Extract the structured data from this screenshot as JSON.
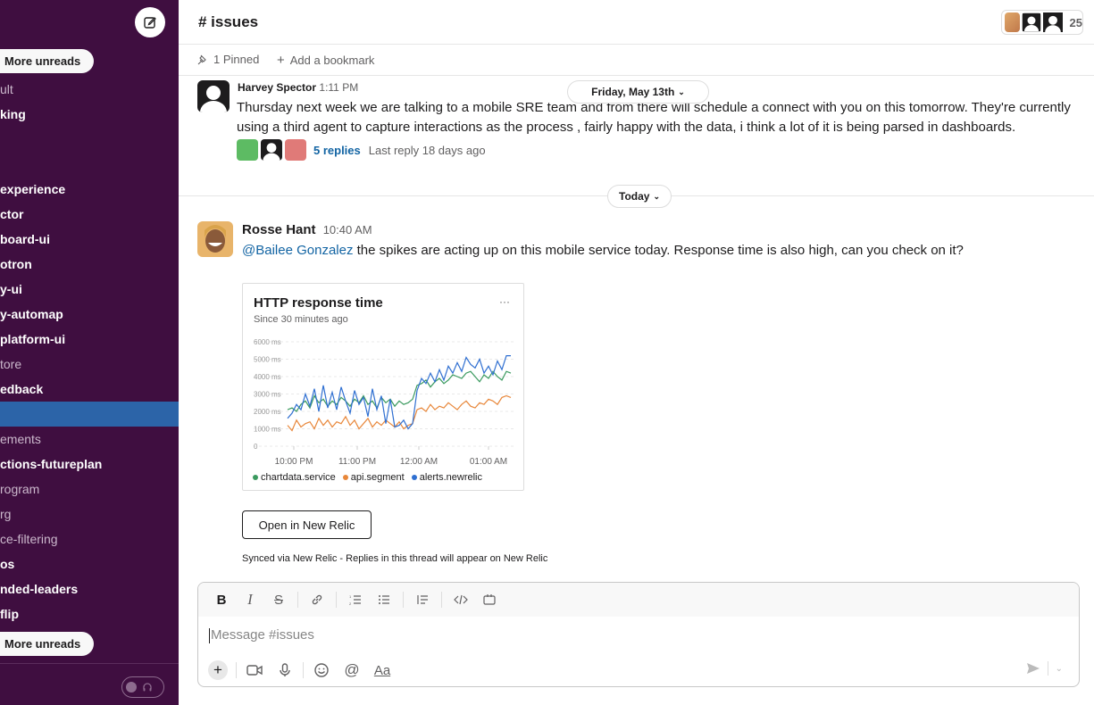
{
  "sidebar": {
    "more_unreads_top": "More unreads",
    "more_unreads_bottom": "More unreads",
    "channels": [
      {
        "label": "ult",
        "style": "dim",
        "top": 92
      },
      {
        "label": "king",
        "style": "bold",
        "top": 120
      },
      {
        "label": "experience",
        "style": "bold",
        "top": 204
      },
      {
        "label": "ctor",
        "style": "bold",
        "top": 232
      },
      {
        "label": "board-ui",
        "style": "bold",
        "top": 260
      },
      {
        "label": "otron",
        "style": "bold",
        "top": 288
      },
      {
        "label": "y-ui",
        "style": "bold",
        "top": 316
      },
      {
        "label": "y-automap",
        "style": "bold",
        "top": 344
      },
      {
        "label": "platform-ui",
        "style": "bold",
        "top": 372
      },
      {
        "label": "tore",
        "style": "dim",
        "top": 400
      },
      {
        "label": "edback",
        "style": "bold",
        "top": 428
      },
      {
        "label": "",
        "style": "selected",
        "top": 456
      },
      {
        "label": "ements",
        "style": "dim",
        "top": 484
      },
      {
        "label": "ctions-futureplan",
        "style": "bold",
        "top": 512
      },
      {
        "label": "rogram",
        "style": "dim",
        "top": 540
      },
      {
        "label": "rg",
        "style": "dim",
        "top": 568
      },
      {
        "label": "ce-filtering",
        "style": "dim",
        "top": 596
      },
      {
        "label": "os",
        "style": "bold",
        "top": 624
      },
      {
        "label": "nded-leaders",
        "style": "bold",
        "top": 652
      },
      {
        "label": "flip",
        "style": "bold",
        "top": 680
      }
    ]
  },
  "header": {
    "channel": "# issues",
    "member_count": "25",
    "pinned": "1 Pinned",
    "add_bookmark": "Add a bookmark"
  },
  "messages": {
    "harvey": {
      "name": "Harvey Spector",
      "time": "1:11 PM",
      "text_line1": "Thursday next week we are talking to a mobile SRE team and from there will schedule a connect with you on this tomorrow. They're currently",
      "text_line2": "using a third  agent to capture interactions as  the process , fairly happy with the data, i think a lot of it is being parsed in dashboards.",
      "replies": "5 replies",
      "last_reply": "Last reply 18 days ago"
    },
    "date_friday": "Friday, May 13th",
    "date_today": "Today",
    "rosse": {
      "name": "Rosse Hant",
      "time": "10:40 AM",
      "mention": "@Bailee Gonzalez",
      "text": " the spikes are acting up on this mobile service today. Response time is also high, can you check on it?"
    }
  },
  "card": {
    "title": "HTTP response time",
    "subtitle": "Since 30 minutes ago",
    "menu": "···",
    "open_button": "Open in New Relic",
    "synced": "Synced via New Relic - Replies in this thread will appear on New Relic"
  },
  "chart_data": {
    "type": "line",
    "title": "HTTP response time",
    "subtitle": "Since 30 minutes ago",
    "y_ticks": [
      "0",
      "1000 ms",
      "2000 ms",
      "3000 ms",
      "4000 ms",
      "5000 ms",
      "6000 ms"
    ],
    "x_ticks": [
      "10:00 PM",
      "11:00 PM",
      "12:00 AM",
      "01:00 AM"
    ],
    "ylim": [
      0,
      6000
    ],
    "grid": true,
    "legend_position": "bottom",
    "series": [
      {
        "name": "chartdata.service",
        "color": "#3b9a5f",
        "values": [
          2100,
          2200,
          2000,
          2400,
          2600,
          2200,
          2900,
          2500,
          2700,
          2300,
          2600,
          2400,
          2800,
          2600,
          2300,
          2700,
          2500,
          2900,
          2400,
          2600,
          2200,
          2800,
          2500,
          2700,
          2300,
          2600,
          2400,
          2500,
          2700,
          3500,
          3600,
          3800,
          3400,
          3700,
          3900,
          3600,
          3800,
          4100,
          4000,
          3900,
          4200,
          4300,
          4000,
          3700,
          4100,
          3900,
          4300,
          4000,
          3800,
          4300,
          4200
        ]
      },
      {
        "name": "api.segment",
        "color": "#e8873a",
        "values": [
          1200,
          900,
          1500,
          1100,
          1300,
          1400,
          1000,
          1600,
          1200,
          1500,
          1100,
          1400,
          1300,
          1700,
          1200,
          1500,
          1000,
          1300,
          1600,
          1100,
          1400,
          1200,
          1500,
          1300,
          1100,
          1400,
          1000,
          1200,
          1300,
          2100,
          2200,
          2000,
          2400,
          2100,
          2300,
          2200,
          2500,
          2300,
          2100,
          2400,
          2600,
          2300,
          2200,
          2500,
          2400,
          2700,
          2600,
          2400,
          2800,
          2900,
          2800
        ]
      },
      {
        "name": "alerts.newrelic",
        "color": "#2f6fd1",
        "values": [
          1600,
          1900,
          2400,
          2100,
          3000,
          2300,
          3300,
          2000,
          3500,
          2200,
          3100,
          2100,
          3400,
          2600,
          1900,
          3200,
          2400,
          2800,
          1700,
          3300,
          2100,
          2900,
          1300,
          2700,
          1100,
          1200,
          1500,
          1000,
          1300,
          3200,
          3900,
          3600,
          4200,
          3700,
          4400,
          3800,
          4600,
          4200,
          4800,
          4300,
          5100,
          4700,
          4500,
          5000,
          4200,
          4600,
          4100,
          4900,
          4400,
          5200,
          5200
        ]
      }
    ]
  },
  "composer": {
    "placeholder": "Message #issues"
  },
  "colors": {
    "sidebar": "#3f0e40",
    "selected": "#2c64a8",
    "link": "#1264a3"
  }
}
